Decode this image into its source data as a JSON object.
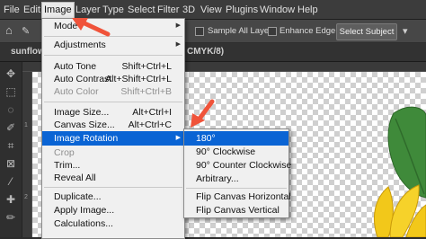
{
  "menubar": {
    "items": [
      "File",
      "Edit",
      "Image",
      "Layer",
      "Type",
      "Select",
      "Filter",
      "3D",
      "View",
      "Plugins",
      "Window",
      "Help"
    ]
  },
  "options": {
    "sample_all_layers": "Sample All Layers",
    "enhance_edge": "Enhance Edge",
    "select_subject": "Select Subject"
  },
  "tabs": {
    "document_partial": "sunflow",
    "document_mode_partial": "CMYK/8)"
  },
  "image_menu": {
    "items": [
      {
        "label": "Mode",
        "shortcut": "",
        "submenu": true,
        "disabled": false
      },
      {
        "label": "Adjustments",
        "shortcut": "",
        "submenu": true,
        "disabled": false
      },
      {
        "label": "Auto Tone",
        "shortcut": "Shift+Ctrl+L",
        "submenu": false,
        "disabled": false
      },
      {
        "label": "Auto Contrast",
        "shortcut": "Alt+Shift+Ctrl+L",
        "submenu": false,
        "disabled": false
      },
      {
        "label": "Auto Color",
        "shortcut": "Shift+Ctrl+B",
        "submenu": false,
        "disabled": true
      },
      {
        "label": "Image Size...",
        "shortcut": "Alt+Ctrl+I",
        "submenu": false,
        "disabled": false
      },
      {
        "label": "Canvas Size...",
        "shortcut": "Alt+Ctrl+C",
        "submenu": false,
        "disabled": false
      },
      {
        "label": "Image Rotation",
        "shortcut": "",
        "submenu": true,
        "disabled": false,
        "highlighted": true
      },
      {
        "label": "Crop",
        "shortcut": "",
        "submenu": false,
        "disabled": true
      },
      {
        "label": "Trim...",
        "shortcut": "",
        "submenu": false,
        "disabled": false
      },
      {
        "label": "Reveal All",
        "shortcut": "",
        "submenu": false,
        "disabled": false
      },
      {
        "label": "Duplicate...",
        "shortcut": "",
        "submenu": false,
        "disabled": false
      },
      {
        "label": "Apply Image...",
        "shortcut": "",
        "submenu": false,
        "disabled": false
      },
      {
        "label": "Calculations...",
        "shortcut": "",
        "submenu": false,
        "disabled": false
      }
    ]
  },
  "rotation_submenu": {
    "items": [
      {
        "label": "180°",
        "highlighted": true
      },
      {
        "label": "90° Clockwise"
      },
      {
        "label": "90° Counter Clockwise"
      },
      {
        "label": "Arbitrary..."
      },
      {
        "label": "Flip Canvas Horizontal"
      },
      {
        "label": "Flip Canvas Vertical"
      }
    ]
  },
  "rulers": {
    "left_numbers": [
      "1",
      "2"
    ]
  },
  "colors": {
    "highlight": "#0a64d4",
    "menu_bg": "#f0f0f0",
    "pointer_arrow": "#f0533a",
    "canvas_check": "#cfcfcf",
    "petal_yellow": "#f2c81a",
    "leaf_green": "#3f8a3a"
  }
}
